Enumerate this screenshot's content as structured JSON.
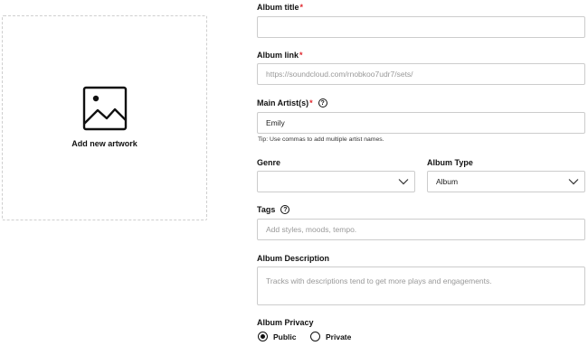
{
  "artwork": {
    "label": "Add new artwork",
    "icon": "image-icon"
  },
  "form": {
    "album_title": {
      "label": "Album title",
      "required": "*",
      "value": ""
    },
    "album_link": {
      "label": "Album link",
      "required": "*",
      "value": "https://soundcloud.com/rnobkoo7udr7/sets/"
    },
    "main_artist": {
      "label": "Main Artist(s)",
      "required": "*",
      "help": "?",
      "value": "Emily",
      "tip": "Tip: Use commas to add multiple artist names."
    },
    "genre": {
      "label": "Genre",
      "value": ""
    },
    "album_type": {
      "label": "Album Type",
      "value": "Album"
    },
    "tags": {
      "label": "Tags",
      "help": "?",
      "placeholder": "Add styles, moods, tempo."
    },
    "description": {
      "label": "Album Description",
      "placeholder": "Tracks with descriptions tend to get more plays and engagements."
    },
    "privacy": {
      "label": "Album Privacy",
      "options": [
        {
          "label": "Public",
          "selected": true
        },
        {
          "label": "Private",
          "selected": false
        }
      ]
    }
  }
}
